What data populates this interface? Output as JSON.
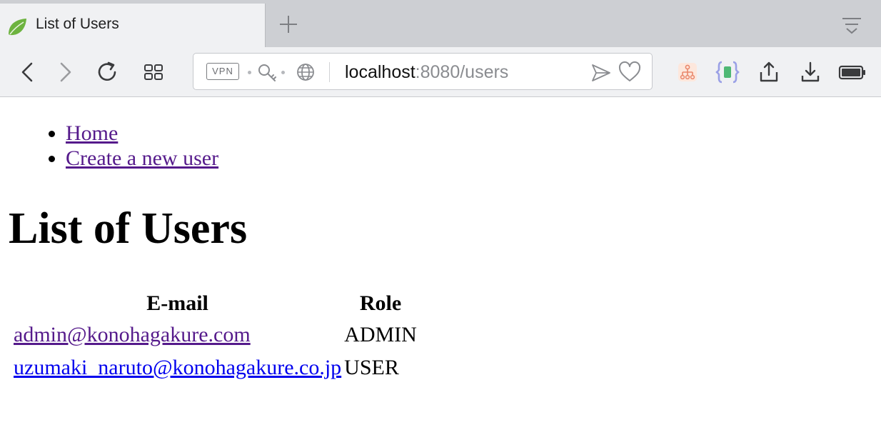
{
  "browser": {
    "tab": {
      "title": "List of Users",
      "favicon": "spring-leaf-icon"
    },
    "toolbar": {
      "back": "back-arrow-icon",
      "forward": "forward-arrow-icon",
      "reload": "reload-icon",
      "tabs_overview": "grid-icon",
      "vpn_label": "VPN",
      "url_host": "localhost",
      "url_rest": ":8080/users",
      "extensions": [
        "sitemap-icon",
        "json-braces-icon"
      ],
      "actions": [
        "share-icon",
        "download-icon",
        "battery-icon"
      ]
    },
    "colors": {
      "tabstrip": "#cdcfd3",
      "toolbar": "#f0f1f3",
      "leaf_green": "#6db33f"
    }
  },
  "page": {
    "nav": [
      {
        "label": "Home"
      },
      {
        "label": "Create a new user"
      }
    ],
    "title": "List of Users",
    "table": {
      "headers": [
        "E-mail",
        "Role"
      ],
      "rows": [
        {
          "email": "admin@konohagakure.com",
          "role": "ADMIN"
        },
        {
          "email": "uzumaki_naruto@konohagakure.co.jp",
          "role": "USER"
        }
      ]
    },
    "colors": {
      "link_visited": "#551a8b",
      "link_unvisited": "#0000ee"
    }
  }
}
